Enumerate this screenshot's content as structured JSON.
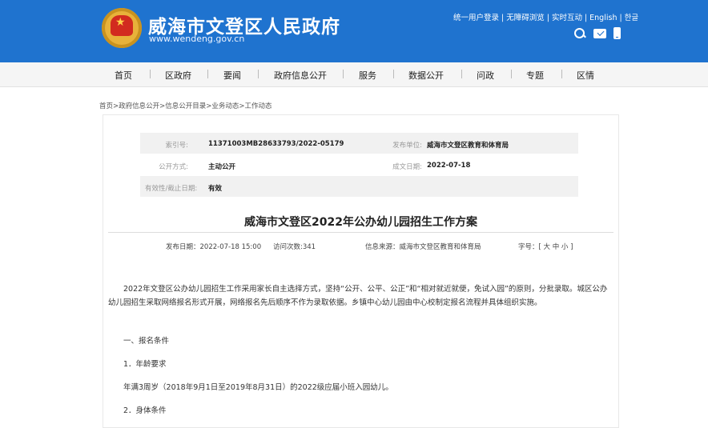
{
  "header": {
    "site_title": "威海市文登区人民政府",
    "site_url": "www.wendeng.gov.cn",
    "top_links": [
      "统一用户登录",
      "无障碍浏览",
      "实时互动",
      "English",
      "한글"
    ],
    "separator": "|"
  },
  "nav": {
    "items": [
      "首页",
      "区政府",
      "要闻",
      "政府信息公开",
      "服务",
      "数据公开",
      "问政",
      "专题",
      "区情"
    ]
  },
  "breadcrumb": "首页>政府信息公开>信息公开目录>业务动态>工作动态",
  "meta": {
    "index_label": "索引号:",
    "index_value": "11371003MB28633793/2022-05179",
    "publisher_label": "发布单位:",
    "publisher_value": "威海市文登区教育和体育局",
    "disclosure_label": "公开方式:",
    "disclosure_value": "主动公开",
    "issue_date_label": "成文日期:",
    "issue_date_value": "2022-07-18",
    "validity_label": "有效性/截止日期:",
    "validity_value": "有效"
  },
  "article": {
    "title": "威海市文登区2022年公办幼儿园招生工作方案",
    "publish_date": "发布日期：2022-07-18 15:00",
    "visits": "访问次数:341",
    "source": "信息来源：威海市文登区教育和体育局",
    "font_size": "字号：[ 大 中 小 ]",
    "intro": "2022年文登区公办幼儿园招生工作采用家长自主选择方式，坚持“公开、公平、公正”和“相对就近就便，免试入园”的原则，分批录取。城区公办幼儿园招生采取网络报名形式开展，网络报名先后顺序不作为录取依据。乡镇中心幼儿园由中心校制定报名流程并具体组织实施。",
    "section1": "一、报名条件",
    "item1": "1．年龄要求",
    "item1_text": "年满3周岁（2018年9月1日至2019年8月31日）的2022级应届小班入园幼儿。",
    "item2": "2．身体条件"
  }
}
